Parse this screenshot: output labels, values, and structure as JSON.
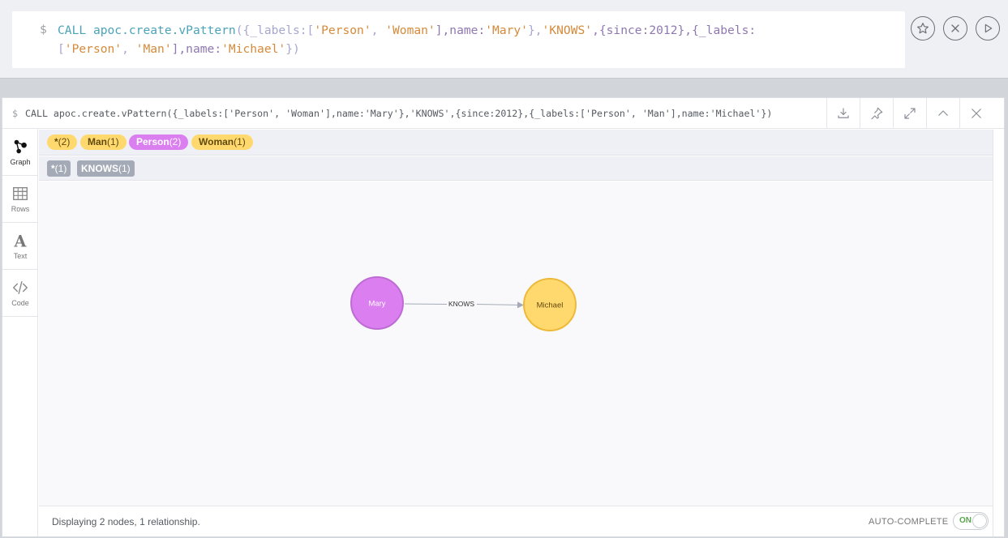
{
  "editor": {
    "prompt": "$",
    "code": {
      "kw": "CALL",
      "fn": "apoc.create.vPattern",
      "p1": "({_labels:[",
      "s1": "'Person'",
      "p2": ", ",
      "s2": "'Woman'",
      "p3": "],name:",
      "s3": "'Mary'",
      "p4": "},",
      "s4": "'KNOWS'",
      "p5": ",{since:",
      "n1": "2012",
      "p6": "},{_labels:",
      "p7": "[",
      "s5": "'Person'",
      "p8": ", ",
      "s6": "'Man'",
      "p9": "],name:",
      "s7": "'Michael'",
      "p10": "})"
    },
    "buttons": [
      {
        "icon": "star-icon"
      },
      {
        "icon": "close-circle-icon"
      },
      {
        "icon": "play-icon"
      }
    ]
  },
  "frame": {
    "prompt": "$",
    "query": "CALL apoc.create.vPattern({_labels:['Person', 'Woman'],name:'Mary'},'KNOWS',{since:2012},{_labels:['Person', 'Man'],name:'Michael'})",
    "header_buttons": [
      "download-icon",
      "pin-icon",
      "expand-icon",
      "collapse-icon",
      "close-icon"
    ]
  },
  "sidebar": {
    "items": [
      {
        "label": "Graph",
        "icon": "graph-icon",
        "active": true
      },
      {
        "label": "Rows",
        "icon": "table-icon",
        "active": false
      },
      {
        "label": "Text",
        "icon": "text-icon",
        "active": false
      },
      {
        "label": "Code",
        "icon": "code-icon",
        "active": false
      }
    ]
  },
  "labels": [
    {
      "name": "*",
      "count": "(2)",
      "color": "#ffd86e"
    },
    {
      "name": "Man",
      "count": "(1)",
      "color": "#ffd86e"
    },
    {
      "name": "Person",
      "count": "(2)",
      "color": "#da7ef0"
    },
    {
      "name": "Woman",
      "count": "(1)",
      "color": "#ffd86e"
    }
  ],
  "relationships": [
    {
      "name": "*",
      "count": "(1)",
      "color": "#a5abb6"
    },
    {
      "name": "KNOWS",
      "count": "(1)",
      "color": "#a5abb6"
    }
  ],
  "graph": {
    "nodes": [
      {
        "name": "Mary",
        "color": "#da7ef0",
        "stroke": "#be6cd4"
      },
      {
        "name": "Michael",
        "color": "#ffd86e",
        "stroke": "#edba39"
      }
    ],
    "edge": {
      "type": "KNOWS",
      "color": "#a5abb6"
    }
  },
  "status": {
    "message": "Displaying 2 nodes, 1 relationship.",
    "autocomplete_label": "AUTO-COMPLETE",
    "toggle_state": "ON"
  }
}
